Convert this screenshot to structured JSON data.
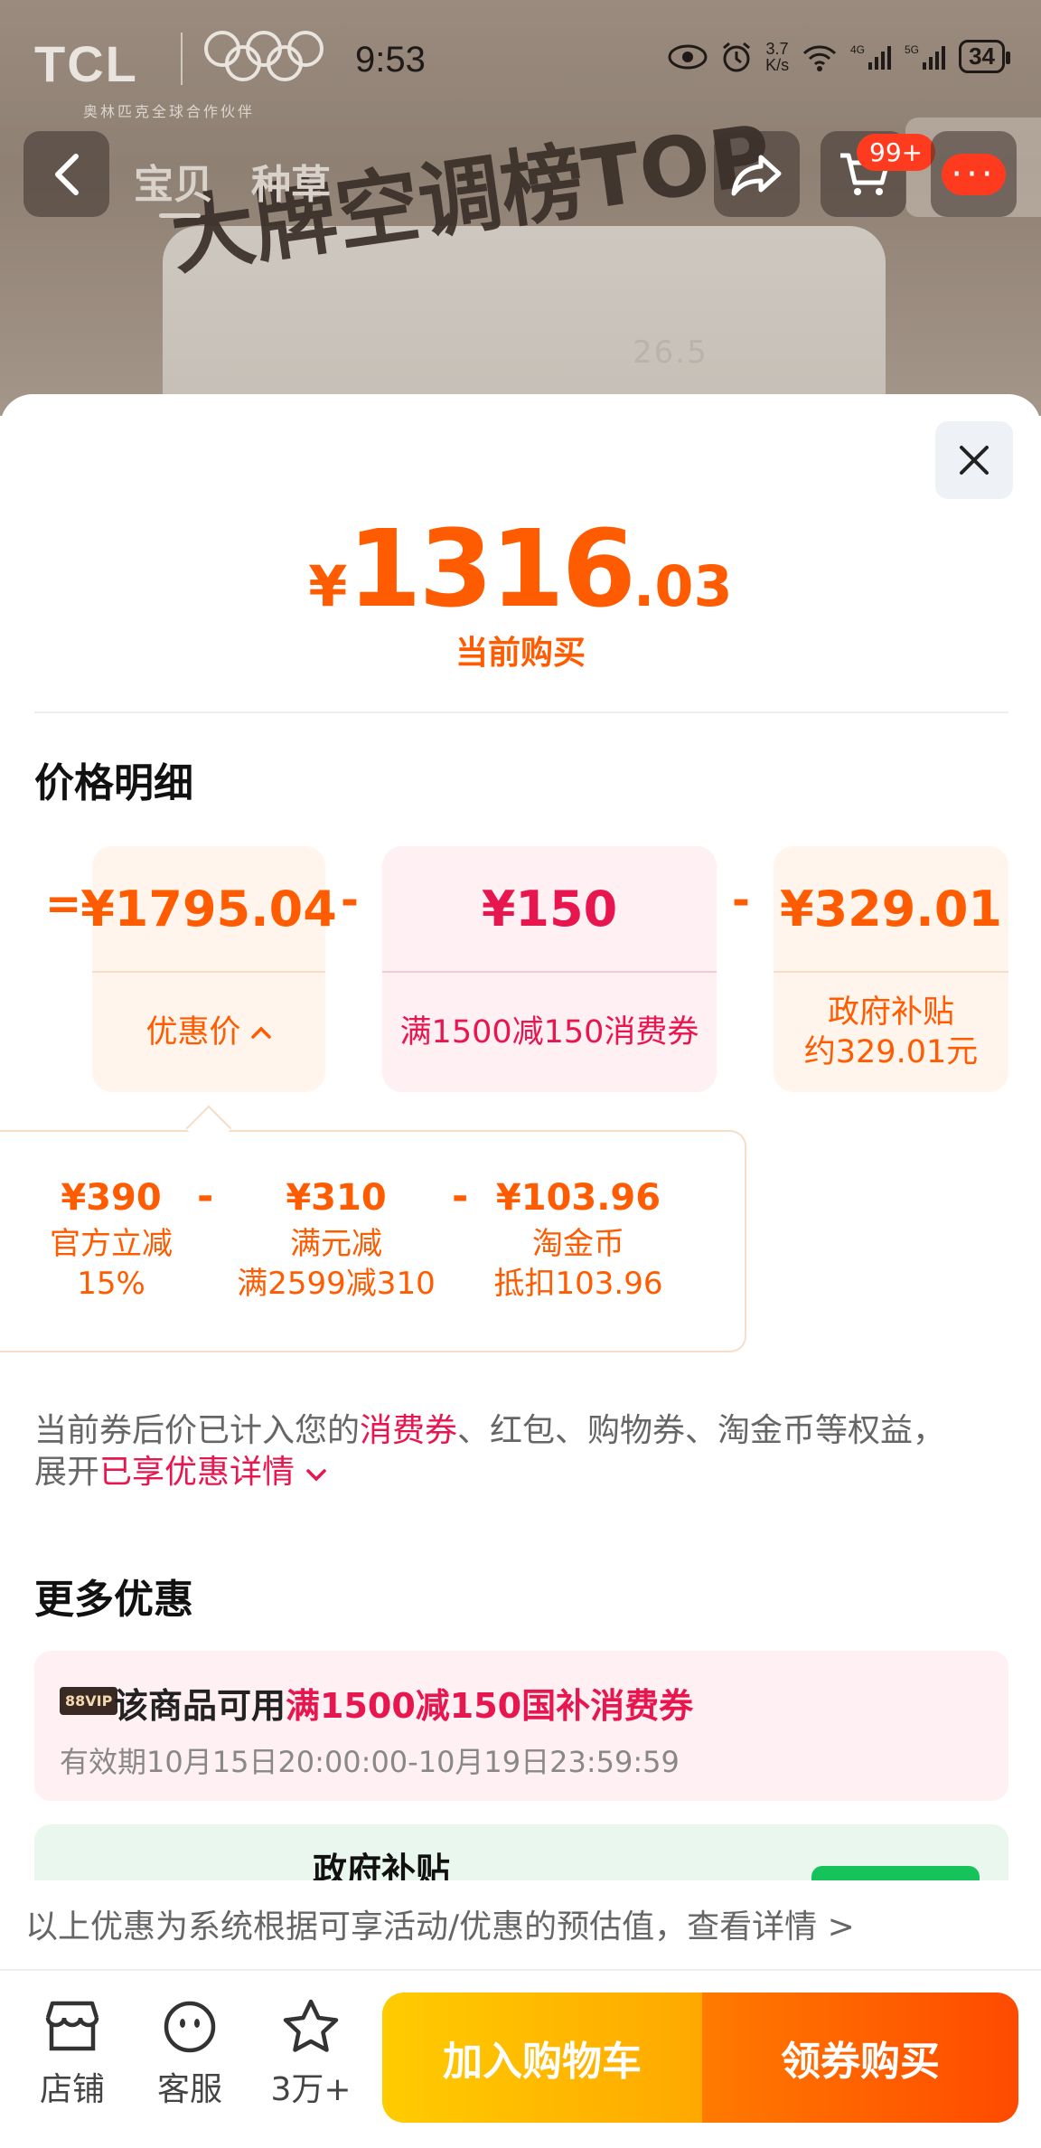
{
  "status_bar": {
    "brand": "TCL",
    "brand_sub": "奥林匹克全球合作伙伴",
    "time": "9:53",
    "speed_value": "3.7",
    "speed_unit": "K/s",
    "battery": "34"
  },
  "header": {
    "tabs": [
      "宝贝",
      "种草"
    ],
    "headline": "大牌空调榜TOP",
    "product_display": "26.5",
    "cart_badge": "99+",
    "more_label": "···"
  },
  "price": {
    "symbol": "¥",
    "integer": "1316",
    "decimal": ".03",
    "subtitle": "当前购买"
  },
  "detail": {
    "title": "价格明细",
    "equals": "=",
    "minus": "-",
    "cards": [
      {
        "value": "¥1795.04",
        "label": "优惠价",
        "chevron": "^"
      },
      {
        "value": "¥150",
        "label": "满1500减150消费券"
      },
      {
        "value": "¥329.01",
        "label_line1": "政府补贴",
        "label_line2": "约329.01元"
      }
    ],
    "breakdown": [
      {
        "value": "¥390",
        "label_line1": "官方立减",
        "label_line2": "15%"
      },
      {
        "value": "¥310",
        "label_line1": "满元减",
        "label_line2": "满2599减310"
      },
      {
        "value": "¥103.96",
        "label_line1": "淘金币",
        "label_line2": "抵扣103.96"
      }
    ]
  },
  "note": {
    "prefix": "当前券后价已计入您的",
    "highlight1": "消费券",
    "middle": "、红包、购物券、淘金币等权益，",
    "line2_prefix": "展开",
    "highlight2": "已享优惠详情"
  },
  "more": {
    "title": "更多优惠",
    "coupon_tag": "88VIP",
    "coupon_prefix": "该商品可用",
    "coupon_highlight": "满1500减150国补消费券",
    "coupon_validity": "有效期10月15日20:00:00-10月19日23:59:59",
    "gov_title": "政府补贴"
  },
  "footnote": "以上优惠为系统根据可享活动/优惠的预估值，查看详情 >",
  "bottom_bar": {
    "store": "店铺",
    "service": "客服",
    "favorites": "3万+",
    "add_cart": "加入购物车",
    "buy": "领券购买"
  },
  "colors": {
    "accent_orange": "#ff5b00",
    "accent_red": "#e8164f",
    "cart_yellow": "#ffcc00",
    "gov_green": "#16c25a"
  }
}
